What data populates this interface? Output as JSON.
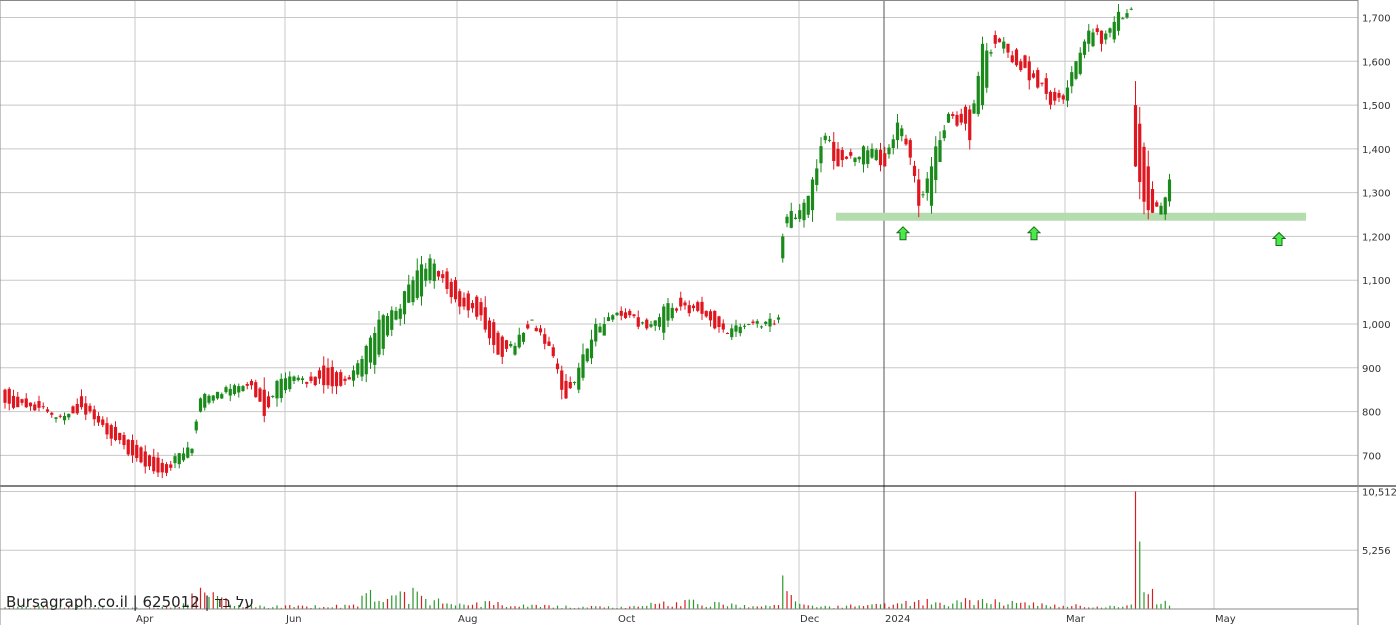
{
  "source_label": "Bursagraph.co.il | 625012 | על בד",
  "colors": {
    "up": "#1a8a1a",
    "down": "#e0161f",
    "grid": "#c8c8c8",
    "support": "#b5dcae",
    "marker": "#4bea4b",
    "volume_up": "#2a9a2a",
    "volume_down": "#d32020"
  },
  "chart_data": {
    "type": "candlestick",
    "x_tick_labels": [
      "Apr",
      "Jun",
      "Aug",
      "Oct",
      "Dec",
      "2024",
      "Mar",
      "May"
    ],
    "price_axis": {
      "ylim": [
        630,
        1740
      ],
      "ticks": [
        700,
        800,
        900,
        1000,
        1100,
        1200,
        1300,
        1400,
        1500,
        1600,
        1700
      ],
      "tick_labels": [
        "700",
        "800",
        "900",
        "1,000",
        "1,100",
        "1,200",
        "1,300",
        "1,400",
        "1,500",
        "1,600",
        "1,700"
      ]
    },
    "volume_axis": {
      "ylim": [
        0,
        11000
      ],
      "ticks": [
        5256,
        10512
      ],
      "tick_labels": [
        "5,256",
        "10,512"
      ]
    },
    "support_level": 1245,
    "marker_prices": [
      1206,
      1206,
      1193
    ],
    "price_anchors": [
      [
        0,
        850,
        820
      ],
      [
        5,
        830,
        810
      ],
      [
        10,
        805,
        800
      ],
      [
        14,
        780,
        790
      ],
      [
        18,
        835,
        810
      ],
      [
        22,
        790,
        775
      ],
      [
        26,
        765,
        735
      ],
      [
        30,
        735,
        700
      ],
      [
        34,
        700,
        675
      ],
      [
        38,
        680,
        660
      ],
      [
        41,
        680,
        705
      ],
      [
        44,
        705,
        715
      ],
      [
        46,
        800,
        830
      ],
      [
        50,
        830,
        845
      ],
      [
        54,
        840,
        860
      ],
      [
        58,
        870,
        860
      ],
      [
        61,
        850,
        790
      ],
      [
        64,
        830,
        870
      ],
      [
        68,
        870,
        880
      ],
      [
        72,
        880,
        870
      ],
      [
        76,
        900,
        860
      ],
      [
        80,
        875,
        870
      ],
      [
        84,
        880,
        920
      ],
      [
        88,
        930,
        1010
      ],
      [
        92,
        1010,
        1030
      ],
      [
        96,
        1050,
        1100
      ],
      [
        100,
        1100,
        1150
      ],
      [
        104,
        1120,
        1080
      ],
      [
        108,
        1060,
        1040
      ],
      [
        112,
        1050,
        1020
      ],
      [
        116,
        980,
        930
      ],
      [
        120,
        930,
        950
      ],
      [
        124,
        1010,
        1010
      ],
      [
        128,
        960,
        950
      ],
      [
        132,
        870,
        830
      ],
      [
        135,
        850,
        900
      ],
      [
        139,
        960,
        1000
      ],
      [
        143,
        1010,
        1020
      ],
      [
        147,
        1030,
        1020
      ],
      [
        151,
        1010,
        990
      ],
      [
        155,
        980,
        1040
      ],
      [
        159,
        1060,
        1040
      ],
      [
        163,
        1050,
        1030
      ],
      [
        167,
        1030,
        990
      ],
      [
        171,
        970,
        990
      ],
      [
        175,
        1000,
        1000
      ],
      [
        179,
        1000,
        1005
      ],
      [
        182,
        1010,
        1015
      ],
      [
        183,
        1150,
        1200
      ],
      [
        184,
        1230,
        1245
      ],
      [
        187,
        1240,
        1260
      ],
      [
        190,
        1260,
        1330
      ],
      [
        193,
        1420,
        1430
      ],
      [
        196,
        1400,
        1360
      ],
      [
        200,
        1370,
        1380
      ],
      [
        204,
        1380,
        1400
      ],
      [
        207,
        1390,
        1360
      ],
      [
        210,
        1420,
        1460
      ],
      [
        213,
        1420,
        1380
      ],
      [
        215,
        1330,
        1270
      ],
      [
        218,
        1270,
        1360
      ],
      [
        220,
        1370,
        1420
      ],
      [
        222,
        1460,
        1480
      ],
      [
        225,
        1480,
        1460
      ],
      [
        227,
        1490,
        1420
      ],
      [
        230,
        1500,
        1640
      ],
      [
        233,
        1660,
        1640
      ],
      [
        236,
        1640,
        1620
      ],
      [
        239,
        1600,
        1580
      ],
      [
        243,
        1580,
        1540
      ],
      [
        247,
        1530,
        1510
      ],
      [
        250,
        1510,
        1540
      ],
      [
        252,
        1560,
        1600
      ],
      [
        255,
        1640,
        1670
      ],
      [
        258,
        1670,
        1640
      ],
      [
        261,
        1650,
        1690
      ],
      [
        264,
        1700,
        1710
      ],
      [
        265,
        1720,
        1720
      ],
      [
        266,
        1500,
        1360
      ],
      [
        269,
        1360,
        1260
      ],
      [
        272,
        1250,
        1270
      ],
      [
        274,
        1280,
        1330
      ]
    ],
    "volume_anchors": [
      [
        0,
        150
      ],
      [
        8,
        250
      ],
      [
        20,
        180
      ],
      [
        28,
        120
      ],
      [
        40,
        200
      ],
      [
        46,
        1900
      ],
      [
        55,
        350
      ],
      [
        70,
        300
      ],
      [
        82,
        400
      ],
      [
        86,
        1700
      ],
      [
        90,
        900
      ],
      [
        96,
        1900
      ],
      [
        104,
        500
      ],
      [
        114,
        700
      ],
      [
        122,
        400
      ],
      [
        130,
        300
      ],
      [
        145,
        200
      ],
      [
        160,
        800
      ],
      [
        168,
        600
      ],
      [
        176,
        250
      ],
      [
        182,
        350
      ],
      [
        183,
        3000
      ],
      [
        184,
        1600
      ],
      [
        188,
        400
      ],
      [
        196,
        300
      ],
      [
        207,
        500
      ],
      [
        215,
        800
      ],
      [
        230,
        900
      ],
      [
        244,
        500
      ],
      [
        260,
        300
      ],
      [
        265,
        400
      ],
      [
        266,
        10512
      ],
      [
        268,
        1500
      ],
      [
        270,
        1800
      ],
      [
        274,
        300
      ]
    ]
  }
}
